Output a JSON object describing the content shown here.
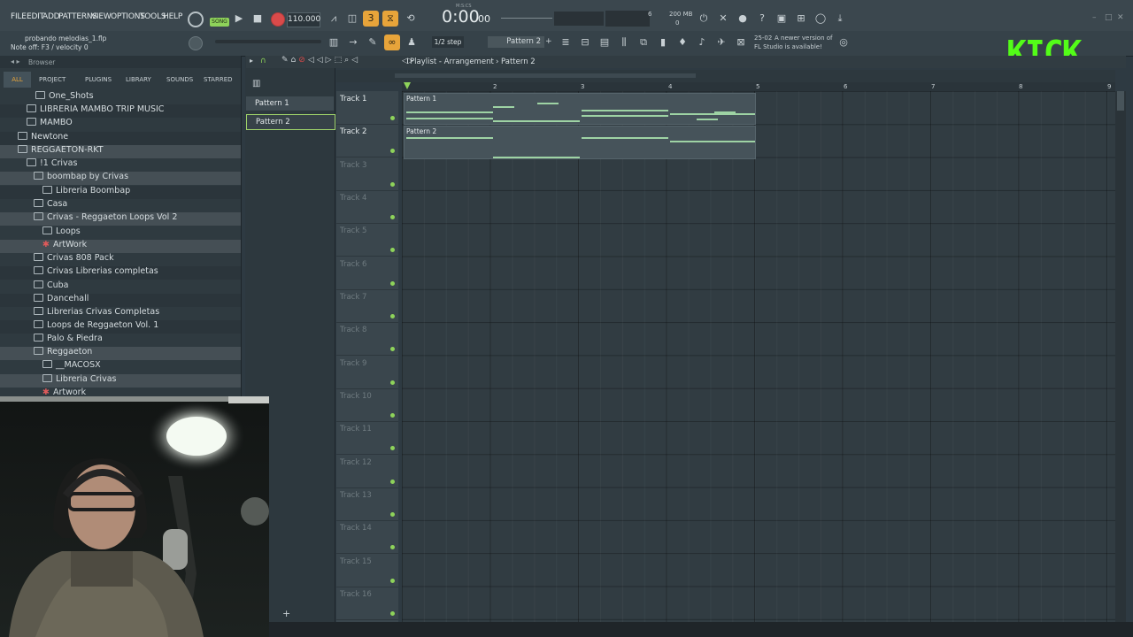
{
  "menu": {
    "file": "FILE",
    "edit": "EDIT",
    "add": "ADD",
    "patterns": "PATTERNS",
    "view": "VIEW",
    "options": "OPTIONS",
    "tools": "TOOLS",
    "help": "HELP"
  },
  "transport": {
    "mode": "SONG",
    "tempo": "110.000",
    "time": "0:00",
    "time_cs": "00",
    "time_unit": "M:S:CS",
    "cpu": "6",
    "ram": "200 MB",
    "voices": "0"
  },
  "project": {
    "filename": "probando melodias_1.flp",
    "hint": "Note off: F3 / velocity 0"
  },
  "snap": {
    "step": "1/2 step",
    "pattern": "Pattern 2"
  },
  "update_notice": {
    "date": "25-02",
    "text": "A newer version of",
    "text2": "FL Studio is available!"
  },
  "brand": {
    "kick_logo": "KICK",
    "color": "#53fc18"
  },
  "browser": {
    "title": "Browser",
    "tabs": [
      "ALL",
      "PROJECT",
      "PLUGINS",
      "LIBRARY",
      "SOUNDS",
      "STARRED"
    ],
    "items": [
      {
        "label": "One_Shots"
      },
      {
        "label": "LIBRERIA MAMBO TRIP MUSIC"
      },
      {
        "label": "MAMBO"
      },
      {
        "label": "Newtone"
      },
      {
        "label": "REGGAETON-RKT"
      },
      {
        "label": "!1 Crivas"
      },
      {
        "label": "boombap by Crivas"
      },
      {
        "label": "Libreria Boombap"
      },
      {
        "label": "Casa"
      },
      {
        "label": "Crivas - Reggaeton Loops Vol 2"
      },
      {
        "label": "Loops"
      },
      {
        "label": "ArtWork"
      },
      {
        "label": "Crivas 808 Pack"
      },
      {
        "label": "Crivas Librerias completas"
      },
      {
        "label": "Cuba"
      },
      {
        "label": "Dancehall"
      },
      {
        "label": "Librerias Crivas Completas"
      },
      {
        "label": "Loops de Reggaeton Vol. 1"
      },
      {
        "label": "Palo & Piedra"
      },
      {
        "label": "Reggaeton"
      },
      {
        "label": "__MACOSX"
      },
      {
        "label": "Libreria Crivas"
      },
      {
        "label": "Artwork"
      }
    ]
  },
  "patterns": [
    "Pattern 1",
    "Pattern 2"
  ],
  "playlist": {
    "title": "Playlist - Arrangement",
    "crumb": "Pattern 2",
    "ruler": [
      "2",
      "3",
      "4",
      "5",
      "6",
      "7",
      "8",
      "9"
    ],
    "tracks": [
      "Track 1",
      "Track 2",
      "Track 3",
      "Track 4",
      "Track 5",
      "Track 6",
      "Track 7",
      "Track 8",
      "Track 9",
      "Track 10",
      "Track 11",
      "Track 12",
      "Track 13",
      "Track 14",
      "Track 15",
      "Track 16"
    ],
    "clips": [
      {
        "label": "Pattern 1",
        "track": 1
      },
      {
        "label": "Pattern 2",
        "track": 2
      }
    ]
  }
}
